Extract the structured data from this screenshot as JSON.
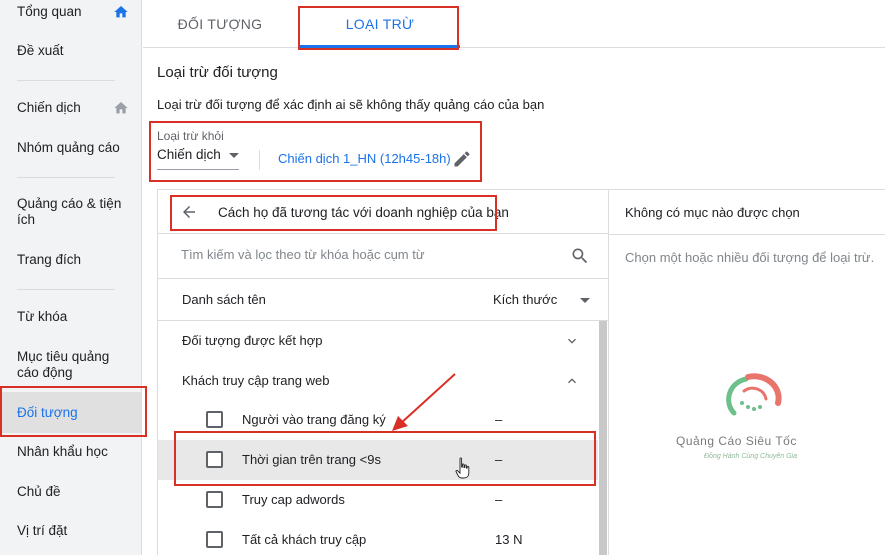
{
  "sidebar": {
    "items": [
      {
        "label": "Tổng quan",
        "icon": "home-icon"
      },
      {
        "label": "Đề xuất"
      },
      {
        "label": "Chiến dịch",
        "icon": "home-icon"
      },
      {
        "label": "Nhóm quảng cáo"
      },
      {
        "label": "Quảng cáo & tiện ích"
      },
      {
        "label": "Trang đích"
      },
      {
        "label": "Từ khóa"
      },
      {
        "label": "Mục tiêu quảng cáo động"
      },
      {
        "label": "Đối tượng",
        "active": true
      },
      {
        "label": "Nhân khẩu học"
      },
      {
        "label": "Chủ đề"
      },
      {
        "label": "Vị trí đặt"
      }
    ]
  },
  "tabs": [
    {
      "label": "ĐỐI TƯỢNG"
    },
    {
      "label": "LOẠI TRỪ",
      "active": true
    }
  ],
  "main": {
    "title": "Loại trừ đối tượng",
    "description": "Loại trừ đối tượng để xác định ai sẽ không thấy quảng cáo của bạn",
    "exclude_from": {
      "label": "Loại trừ khỏi",
      "selected": "Chiến dịch",
      "campaign": "Chiến dịch 1_HN (12h45-18h)"
    }
  },
  "left_panel": {
    "back_label": "Cách họ đã tương tác với doanh nghiệp của bạn",
    "search_placeholder": "Tìm kiếm và lọc theo từ khóa hoặc cụm từ",
    "header_name": "Danh sách tên",
    "header_size": "Kích thước",
    "groups": [
      {
        "label": "Đối tượng được kết hợp",
        "expanded": false
      },
      {
        "label": "Khách truy cập trang web",
        "expanded": true
      }
    ],
    "items": [
      {
        "label": "Người vào trang đăng ký",
        "size": "–"
      },
      {
        "label": "Thời gian trên trang <9s",
        "size": "–",
        "highlighted": true
      },
      {
        "label": "Truy cap adwords",
        "size": "–"
      },
      {
        "label": "Tất cả khách truy cập",
        "size": "13 N"
      }
    ]
  },
  "right_panel": {
    "header": "Không có mục nào được chọn",
    "empty_text": "Chọn một hoặc nhiều đối tượng để loại trừ."
  },
  "watermark": {
    "name": "Quảng Cáo Siêu Tốc",
    "tagline": "Đồng Hành Cùng Chuyên Gia"
  },
  "colors": {
    "accent": "#1a73e8",
    "annotation": "#d93025"
  }
}
